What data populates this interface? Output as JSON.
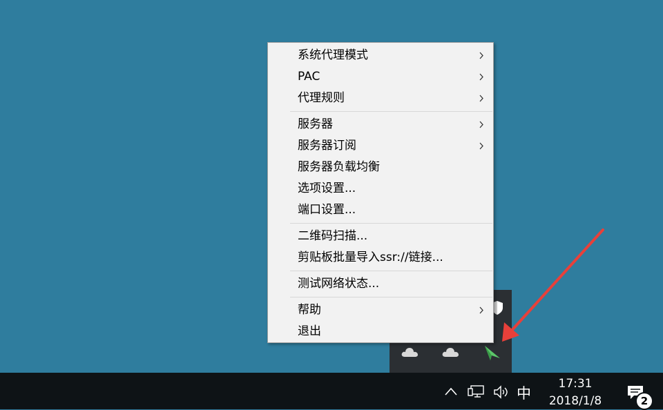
{
  "menu": {
    "groups": [
      [
        {
          "label": "系统代理模式",
          "submenu": true
        },
        {
          "label": "PAC",
          "submenu": true
        },
        {
          "label": "代理规则",
          "submenu": true
        }
      ],
      [
        {
          "label": "服务器",
          "submenu": true
        },
        {
          "label": "服务器订阅",
          "submenu": true
        },
        {
          "label": "服务器负载均衡",
          "submenu": false
        },
        {
          "label": "选项设置...",
          "submenu": false
        },
        {
          "label": "端口设置...",
          "submenu": false
        }
      ],
      [
        {
          "label": "二维码扫描...",
          "submenu": false
        },
        {
          "label": "剪贴板批量导入ssr://链接...",
          "submenu": false
        }
      ],
      [
        {
          "label": "测试网络状态...",
          "submenu": false
        }
      ],
      [
        {
          "label": "帮助",
          "submenu": true
        },
        {
          "label": "退出",
          "submenu": false
        }
      ]
    ]
  },
  "taskbar": {
    "ime_label": "中",
    "time": "17:31",
    "date": "2018/1/8",
    "notification_count": "2"
  },
  "colors": {
    "desktop": "#2f7d9e",
    "taskbar": "#0e1316",
    "menu_bg": "#f2f2f2",
    "annotation_arrow": "#e8403a",
    "ssr_icon": "#5cc86a"
  },
  "icons": {
    "tray_overflow": [
      "cloud-icon",
      "cloud-icon",
      "paper-plane-icon",
      "shield-icon"
    ],
    "taskbar": [
      "chevron-up-icon",
      "network-icon",
      "speaker-icon",
      "notification-icon"
    ]
  }
}
